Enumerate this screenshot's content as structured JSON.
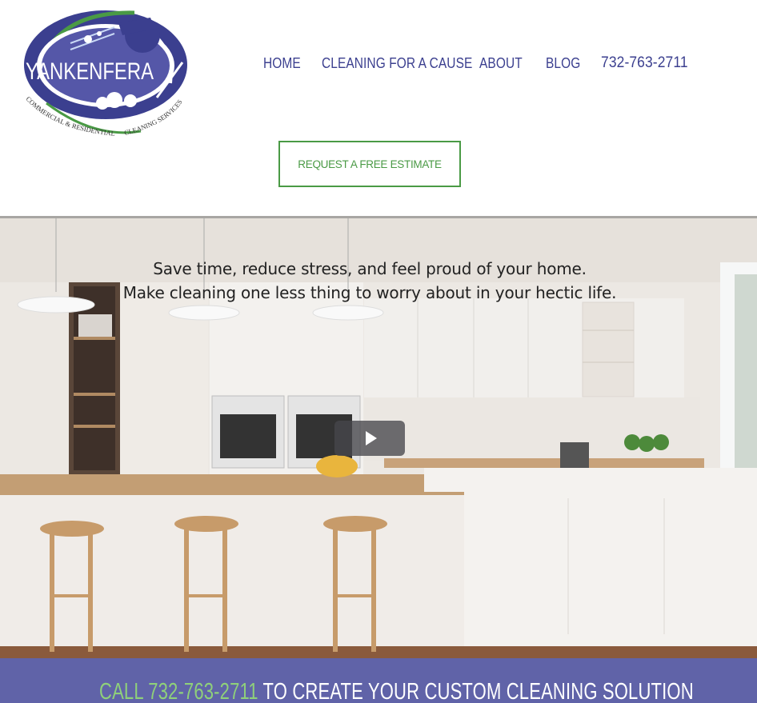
{
  "brand": {
    "name": "YANKENFERA",
    "tagline_left": "COMMERCIAL & RESIDENTIAL",
    "tagline_right": "CLEANING SERVICES",
    "colors": {
      "navy": "#3b3f8f",
      "green": "#4a9a45",
      "banner": "#6063a8",
      "banner_green": "#8fd07a"
    }
  },
  "nav": {
    "items": [
      "HOME",
      "CLEANING FOR A CAUSE",
      "ABOUT",
      "BLOG"
    ],
    "phone": "732-763-2711"
  },
  "cta": {
    "label": "REQUEST A FREE ESTIMATE"
  },
  "hero": {
    "line1": "Save time, reduce stress, and feel proud of your home.",
    "line2": "Make cleaning one less thing to worry about in your hectic life.",
    "play_icon": "play-icon"
  },
  "banner": {
    "call": "CALL",
    "phone": "732-763-2711",
    "rest": "TO CREATE YOUR CUSTOM CLEANING SOLUTION"
  }
}
